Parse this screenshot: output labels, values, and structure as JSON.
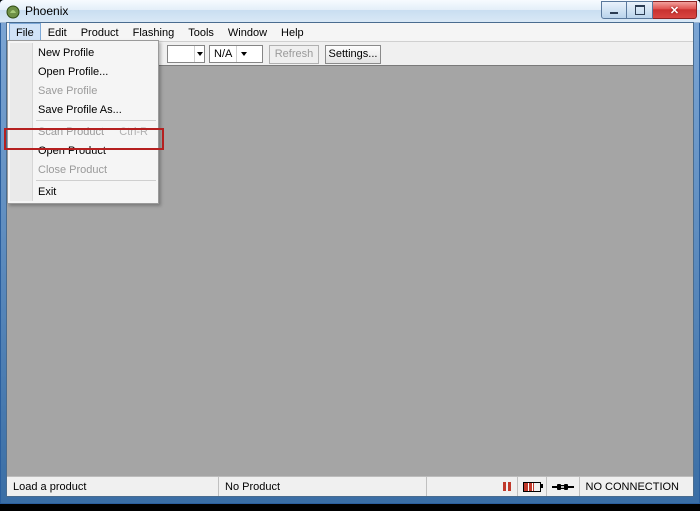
{
  "window": {
    "title": "Phoenix"
  },
  "menu": {
    "file": "File",
    "edit": "Edit",
    "product": "Product",
    "flashing": "Flashing",
    "tools": "Tools",
    "window": "Window",
    "help": "Help"
  },
  "toolbar": {
    "combo1_value": "",
    "combo2_value": "N/A",
    "refresh": "Refresh",
    "settings": "Settings..."
  },
  "file_menu": {
    "new_profile": "New Profile",
    "open_profile": "Open Profile...",
    "save_profile": "Save Profile",
    "save_profile_as": "Save Profile As...",
    "scan_product": "Scan Product",
    "scan_product_shortcut": "Ctrl-R",
    "open_product": "Open Product",
    "close_product": "Close Product",
    "exit": "Exit"
  },
  "status": {
    "left": "Load a product",
    "center": "No Product",
    "connection": "NO CONNECTION"
  }
}
